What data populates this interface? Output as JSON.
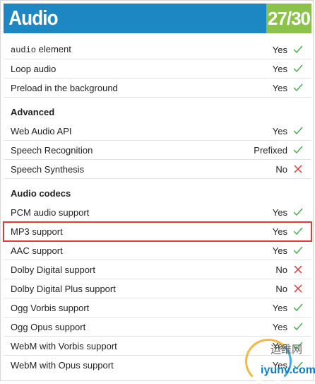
{
  "header": {
    "title": "Audio",
    "score": "27/30",
    "colors": {
      "title_bg": "#1d87c4",
      "score_bg": "#8bc34a"
    }
  },
  "rows_top": [
    {
      "code": "audio",
      "label": " element",
      "value": "Yes",
      "status": "check"
    },
    {
      "label": "Loop audio",
      "value": "Yes",
      "status": "check"
    },
    {
      "label": "Preload in the background",
      "value": "Yes",
      "status": "check"
    }
  ],
  "sections": {
    "advanced": {
      "title": "Advanced",
      "rows": [
        {
          "label": "Web Audio API",
          "value": "Yes",
          "status": "check"
        },
        {
          "label": "Speech Recognition",
          "value": "Prefixed",
          "status": "check"
        },
        {
          "label": "Speech Synthesis",
          "value": "No",
          "status": "cross"
        }
      ]
    },
    "codecs": {
      "title": "Audio codecs",
      "rows": [
        {
          "label": "PCM audio support",
          "value": "Yes",
          "status": "check"
        },
        {
          "label": "MP3 support",
          "value": "Yes",
          "status": "check",
          "highlighted": true
        },
        {
          "label": "AAC support",
          "value": "Yes",
          "status": "check"
        },
        {
          "label": "Dolby Digital support",
          "value": "No",
          "status": "cross"
        },
        {
          "label": "Dolby Digital Plus support",
          "value": "No",
          "status": "cross"
        },
        {
          "label": "Ogg Vorbis support",
          "value": "Yes",
          "status": "check"
        },
        {
          "label": "Ogg Opus support",
          "value": "Yes",
          "status": "check"
        },
        {
          "label": "WebM with Vorbis support",
          "value": "Yes",
          "status": "check"
        },
        {
          "label": "WebM with Opus support",
          "value": "Yes",
          "status": "check"
        }
      ]
    }
  },
  "icons": {
    "check": "check-icon",
    "cross": "cross-icon"
  },
  "colors": {
    "check": "#4caf50",
    "cross": "#e53935",
    "highlight": "#e53935"
  },
  "watermark": {
    "line1": "运维网",
    "line2": "iyunv.com"
  }
}
